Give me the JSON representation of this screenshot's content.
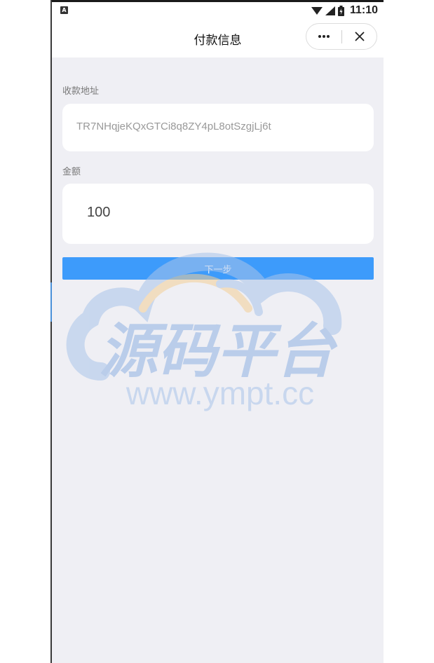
{
  "status_bar": {
    "time": "11:10",
    "left_icon": "a-icon",
    "icons": [
      "wifi-icon",
      "signal-icon",
      "battery-icon"
    ]
  },
  "nav": {
    "title": "付款信息",
    "more_icon": "more-dots-icon",
    "close_icon": "close-icon"
  },
  "form": {
    "address_label": "收款地址",
    "address_value": "TR7NHqjeKQxGTCi8q8ZY4pL8otSzgjLj6t",
    "amount_label": "金额",
    "amount_value": "100"
  },
  "next_button": {
    "label": "下一步"
  },
  "watermark": {
    "cn_text": "源码平台",
    "url_text": "www.ympt.cc"
  },
  "colors": {
    "page_bg": "#efeff4",
    "button_bg": "#3d9bfb",
    "watermark_blue": "#a9c4ea",
    "watermark_orange": "#f3cf96"
  }
}
